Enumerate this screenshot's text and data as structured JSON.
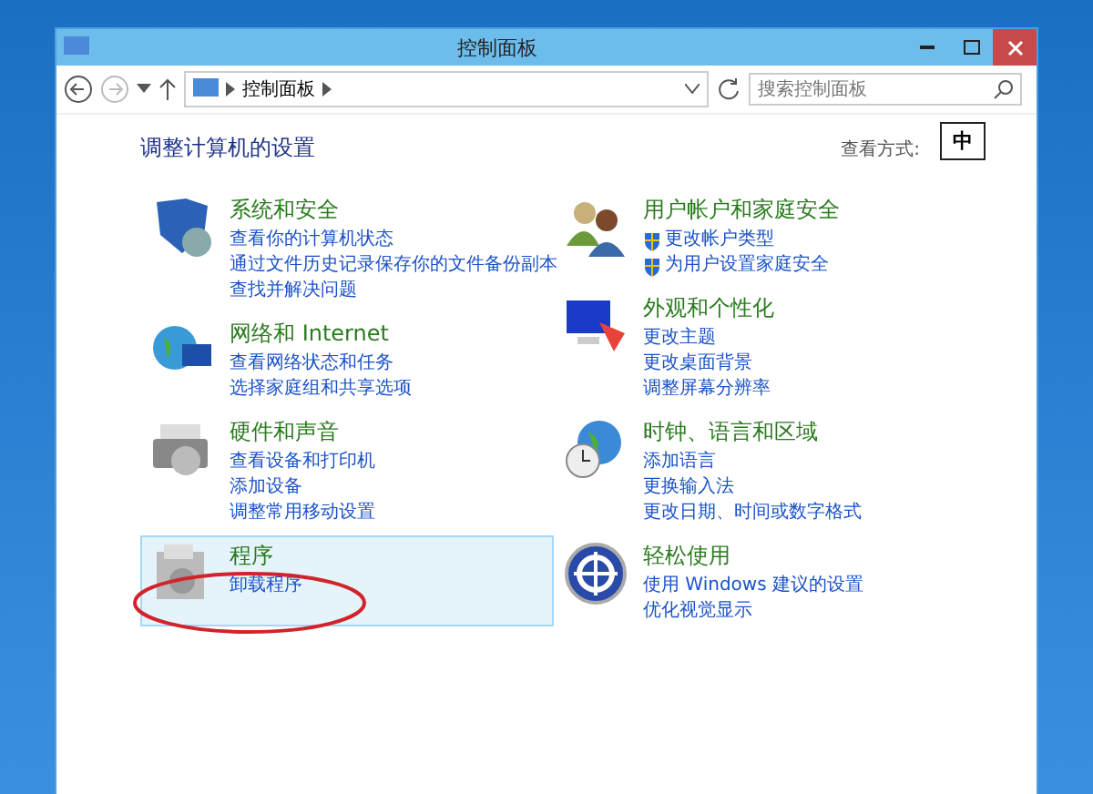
{
  "window": {
    "title": "控制面板"
  },
  "address_bar": {
    "path": [
      "控制面板"
    ]
  },
  "search": {
    "placeholder": "搜索控制面板"
  },
  "heading": "调整计算机的设置",
  "view_by": {
    "label": "查看方式:"
  },
  "ime_indicator": "中",
  "columns": [
    [
      {
        "title": "系统和安全",
        "selected": false,
        "links": [
          {
            "text": "查看你的计算机状态",
            "shield": false
          },
          {
            "text": "通过文件历史记录保存你的文件备份副本",
            "shield": false
          },
          {
            "text": "查找并解决问题",
            "shield": false
          }
        ]
      },
      {
        "title": "网络和 Internet",
        "selected": false,
        "links": [
          {
            "text": "查看网络状态和任务",
            "shield": false
          },
          {
            "text": "选择家庭组和共享选项",
            "shield": false
          }
        ]
      },
      {
        "title": "硬件和声音",
        "selected": false,
        "links": [
          {
            "text": "查看设备和打印机",
            "shield": false
          },
          {
            "text": "添加设备",
            "shield": false
          },
          {
            "text": "调整常用移动设置",
            "shield": false
          }
        ]
      },
      {
        "title": "程序",
        "selected": true,
        "circled": true,
        "links": [
          {
            "text": "卸载程序",
            "shield": false
          }
        ]
      }
    ],
    [
      {
        "title": "用户帐户和家庭安全",
        "selected": false,
        "links": [
          {
            "text": "更改帐户类型",
            "shield": true
          },
          {
            "text": "为用户设置家庭安全",
            "shield": true
          }
        ]
      },
      {
        "title": "外观和个性化",
        "selected": false,
        "links": [
          {
            "text": "更改主题",
            "shield": false
          },
          {
            "text": "更改桌面背景",
            "shield": false
          },
          {
            "text": "调整屏幕分辨率",
            "shield": false
          }
        ]
      },
      {
        "title": "时钟、语言和区域",
        "selected": false,
        "links": [
          {
            "text": "添加语言",
            "shield": false
          },
          {
            "text": "更换输入法",
            "shield": false
          },
          {
            "text": "更改日期、时间或数字格式",
            "shield": false
          }
        ]
      },
      {
        "title": "轻松使用",
        "selected": false,
        "links": [
          {
            "text": "使用 Windows 建议的设置",
            "shield": false
          },
          {
            "text": "优化视觉显示",
            "shield": false
          }
        ]
      }
    ]
  ]
}
